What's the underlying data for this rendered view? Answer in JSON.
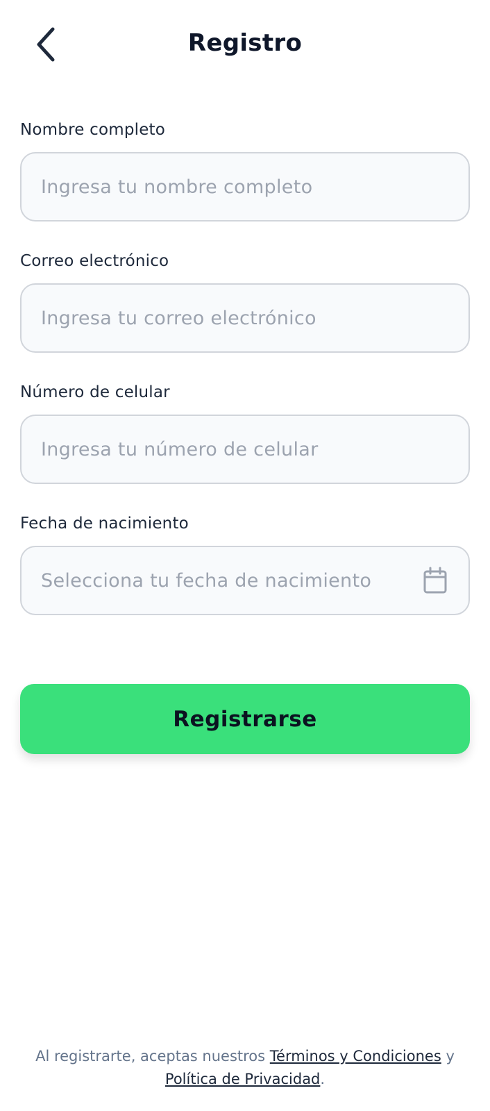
{
  "header": {
    "back_icon": "chevron-left-icon",
    "title": "Registro"
  },
  "form": {
    "fields": [
      {
        "label": "Nombre completo",
        "placeholder": "Ingresa tu nombre completo",
        "value": ""
      },
      {
        "label": "Correo electrónico",
        "placeholder": "Ingresa tu correo electrónico",
        "value": ""
      },
      {
        "label": "Número de celular",
        "placeholder": "Ingresa tu número de celular",
        "value": ""
      },
      {
        "label": "Fecha de nacimiento",
        "placeholder": "Selecciona tu fecha de nacimiento",
        "value": "",
        "icon": "calendar-icon"
      }
    ],
    "submit_label": "Registrarse"
  },
  "legal": {
    "prefix": "Al registrarte, aceptas nuestros ",
    "terms_link": "Términos y Condiciones",
    "conjunction": " y ",
    "privacy_link": "Política de Privacidad",
    "suffix": "."
  },
  "colors": {
    "accent": "#3ae07b",
    "title": "#0f172a",
    "placeholder": "#9ca3af",
    "input_bg": "#f8fafc",
    "input_border": "#d1d5db"
  }
}
